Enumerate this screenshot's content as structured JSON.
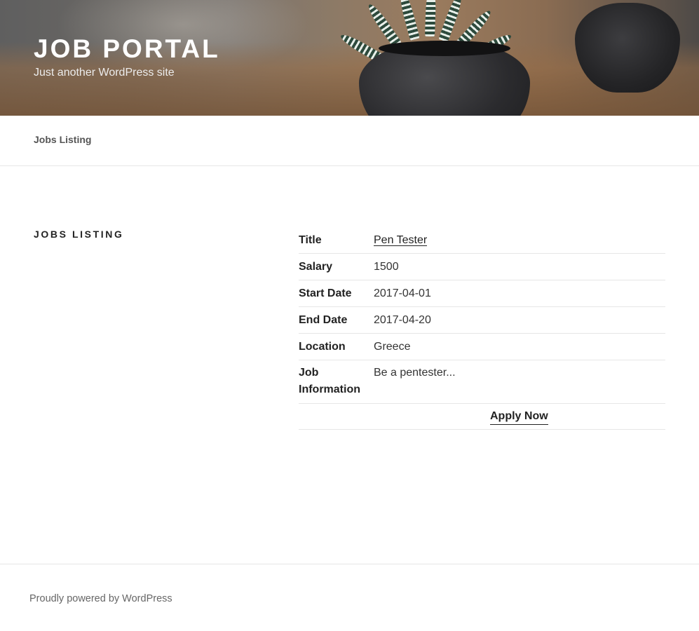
{
  "site": {
    "title": "JOB PORTAL",
    "tagline": "Just another WordPress site"
  },
  "nav": {
    "items": [
      {
        "label": "Jobs Listing"
      }
    ]
  },
  "main": {
    "page_title": "JOBS LISTING",
    "job": {
      "rows": [
        {
          "label": "Title",
          "value": "Pen Tester"
        },
        {
          "label": "Salary",
          "value": "1500"
        },
        {
          "label": "Start Date",
          "value": "2017-04-01"
        },
        {
          "label": "End Date",
          "value": "2017-04-20"
        },
        {
          "label": "Location",
          "value": "Greece"
        },
        {
          "label": "Job Information",
          "value": "Be a pentester..."
        }
      ],
      "apply_label": "Apply Now"
    }
  },
  "footer": {
    "credit": "Proudly powered by WordPress"
  },
  "colors": {
    "text": "#222222",
    "muted": "#666666",
    "border": "#e6e6e6",
    "header_title": "#ffffff"
  }
}
